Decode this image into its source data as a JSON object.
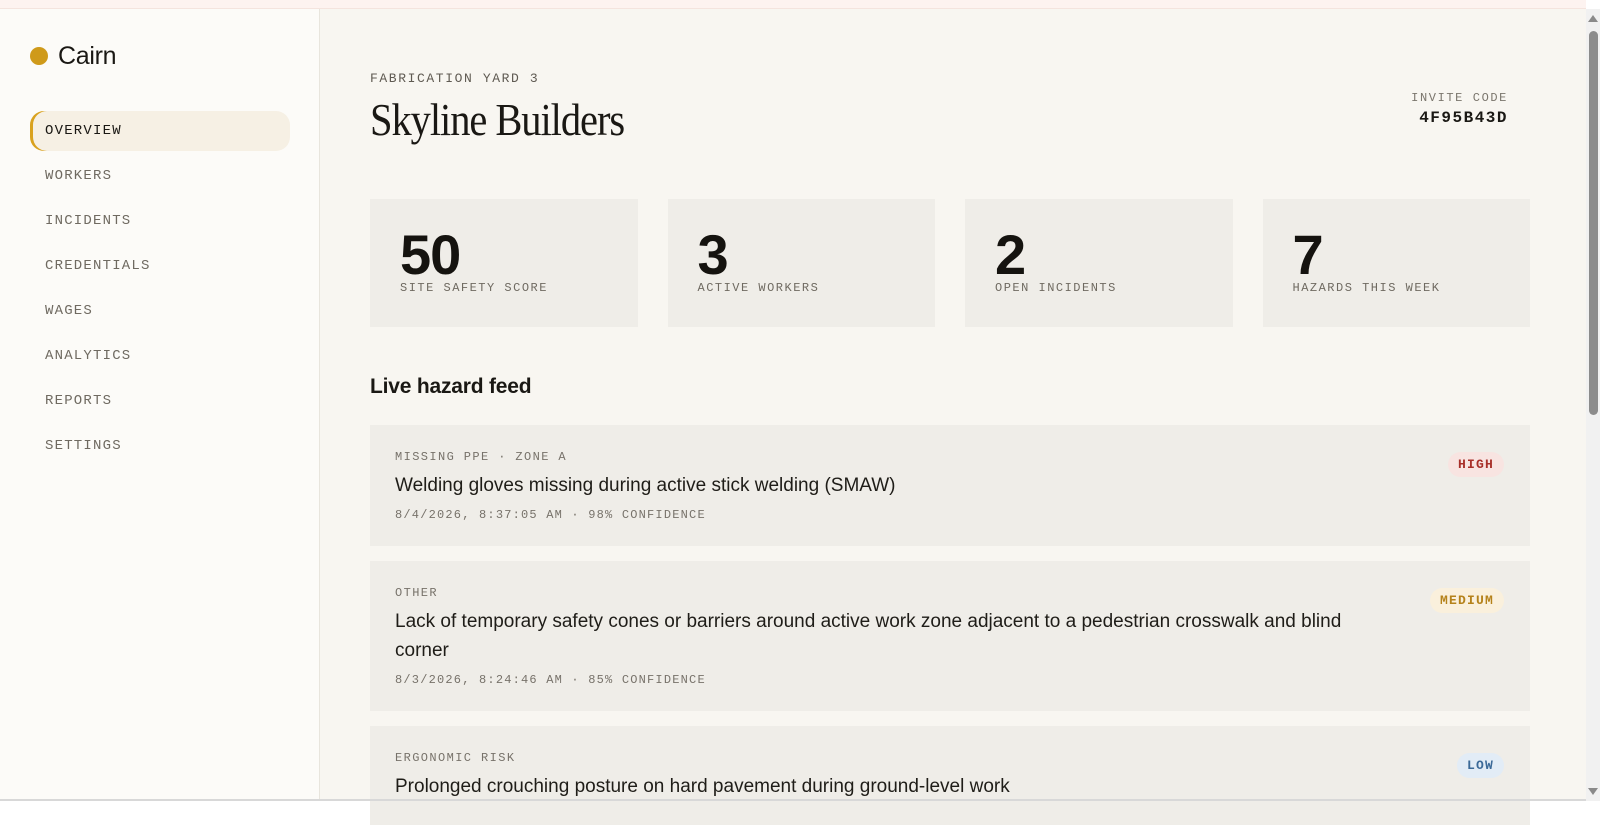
{
  "brand": {
    "name": "Cairn",
    "accent": "#cf9a1a"
  },
  "nav": {
    "items": [
      {
        "label": "OVERVIEW",
        "active": true
      },
      {
        "label": "WORKERS"
      },
      {
        "label": "INCIDENTS"
      },
      {
        "label": "CREDENTIALS"
      },
      {
        "label": "WAGES"
      },
      {
        "label": "ANALYTICS"
      },
      {
        "label": "REPORTS"
      },
      {
        "label": "SETTINGS"
      }
    ]
  },
  "header": {
    "eyebrow": "FABRICATION YARD 3",
    "title": "Skyline Builders",
    "invite_label": "INVITE CODE",
    "invite_code": "4F95B43D"
  },
  "stats": [
    {
      "value": "50",
      "label": "SITE SAFETY SCORE"
    },
    {
      "value": "3",
      "label": "ACTIVE WORKERS"
    },
    {
      "value": "2",
      "label": "OPEN INCIDENTS"
    },
    {
      "value": "7",
      "label": "HAZARDS THIS WEEK"
    }
  ],
  "feed": {
    "title": "Live hazard feed",
    "items": [
      {
        "meta": "MISSING PPE · ZONE A",
        "text": "Welding gloves missing during active stick welding (SMAW)",
        "time": "8/4/2026, 8:37:05 AM · 98% CONFIDENCE",
        "severity": "HIGH"
      },
      {
        "meta": "OTHER",
        "text": "Lack of temporary safety cones or barriers around active work zone adjacent to a pedestrian crosswalk and blind corner",
        "time": "8/3/2026, 8:24:46 AM · 85% CONFIDENCE",
        "severity": "MEDIUM"
      },
      {
        "meta": "ERGONOMIC RISK",
        "text": "Prolonged crouching posture on hard pavement during ground-level work",
        "time": "",
        "severity": "LOW"
      }
    ]
  },
  "colors": {
    "high": "#a8302a",
    "medium": "#b5821a",
    "low": "#3c6a98"
  }
}
